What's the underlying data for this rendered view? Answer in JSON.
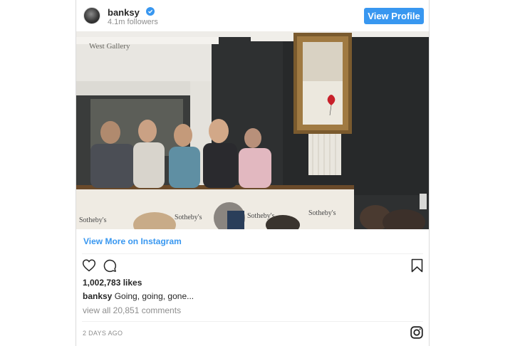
{
  "post": {
    "username": "banksy",
    "followers": "4.1m followers",
    "view_profile_label": "View Profile",
    "verified_icon": "verified-badge-icon",
    "photo_signage": {
      "gallery_sign": "West Gallery",
      "podium_logos": [
        "Sotheby's",
        "Sotheby's",
        "Sotheby's",
        "Sotheby's"
      ]
    },
    "view_more_label": "View More on Instagram",
    "likes": "1,002,783 likes",
    "caption_user": "banksy",
    "caption_text": "Going, going, gone...",
    "comments_link": "view all 20,851 comments",
    "timestamp": "2 DAYS AGO",
    "colors": {
      "accent": "#3897f0",
      "muted": "#8e8e8e",
      "text": "#262626"
    },
    "icons": [
      "heart-icon",
      "comment-icon",
      "bookmark-icon",
      "instagram-logo-icon"
    ]
  }
}
